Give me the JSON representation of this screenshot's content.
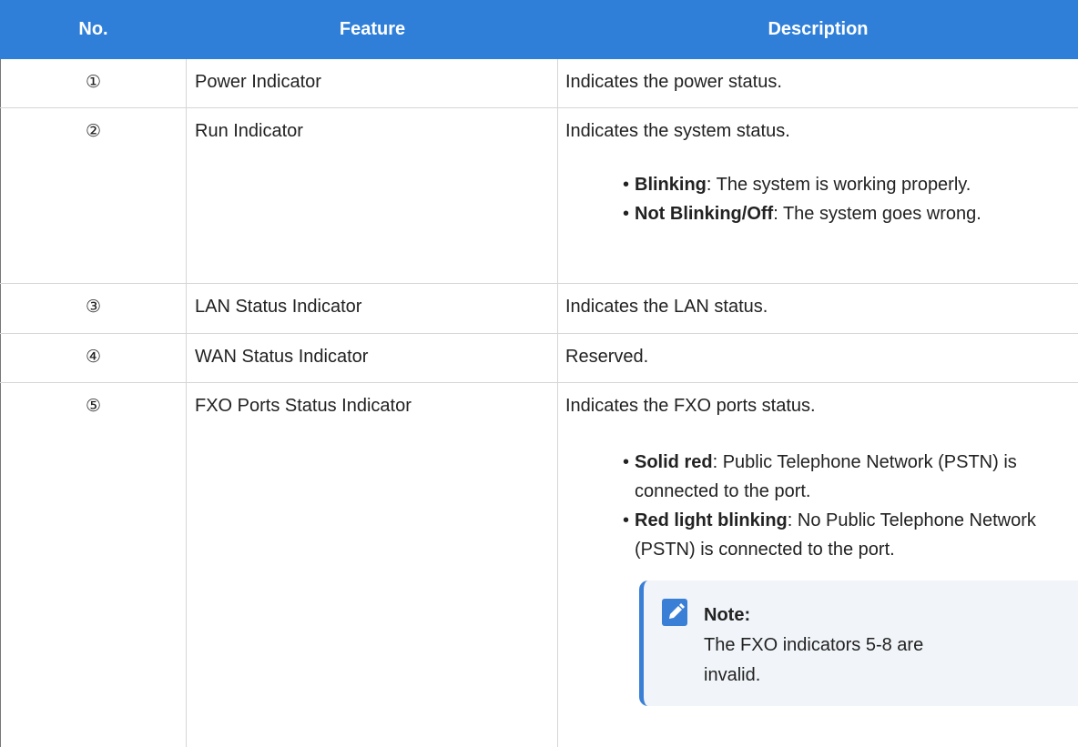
{
  "header": {
    "no": "No.",
    "feature": "Feature",
    "description": "Description"
  },
  "rows": [
    {
      "no": "①",
      "feature": "Power Indicator",
      "description": "Indicates the power status."
    },
    {
      "no": "②",
      "feature": "Run Indicator",
      "description": "Indicates the system status.",
      "bullets": [
        {
          "bold": "Blinking",
          "text": ": The system is working properly."
        },
        {
          "bold": "Not Blinking/Off",
          "text": ": The system goes wrong."
        }
      ]
    },
    {
      "no": "③",
      "feature": "LAN Status Indicator",
      "description": "Indicates the LAN status."
    },
    {
      "no": "④",
      "feature": "WAN Status Indicator",
      "description": "Reserved."
    },
    {
      "no": "⑤",
      "feature": "FXO Ports Status Indicator",
      "description": "Indicates the FXO ports status.",
      "bullets": [
        {
          "bold": "Solid red",
          "text": ": Public Telephone Network (PSTN) is connected to the port."
        },
        {
          "bold": "Red light blinking",
          "text": ": No Public Telephone Network (PSTN) is connected to the port."
        }
      ],
      "note": {
        "title": "Note:",
        "text": "The FXO indicators 5-8 are invalid."
      }
    }
  ],
  "colors": {
    "header_bg": "#2f7fd9",
    "note_accent": "#3a7fd6",
    "note_bg": "#f1f4f8"
  },
  "icons": {
    "note": "pencil-icon"
  }
}
